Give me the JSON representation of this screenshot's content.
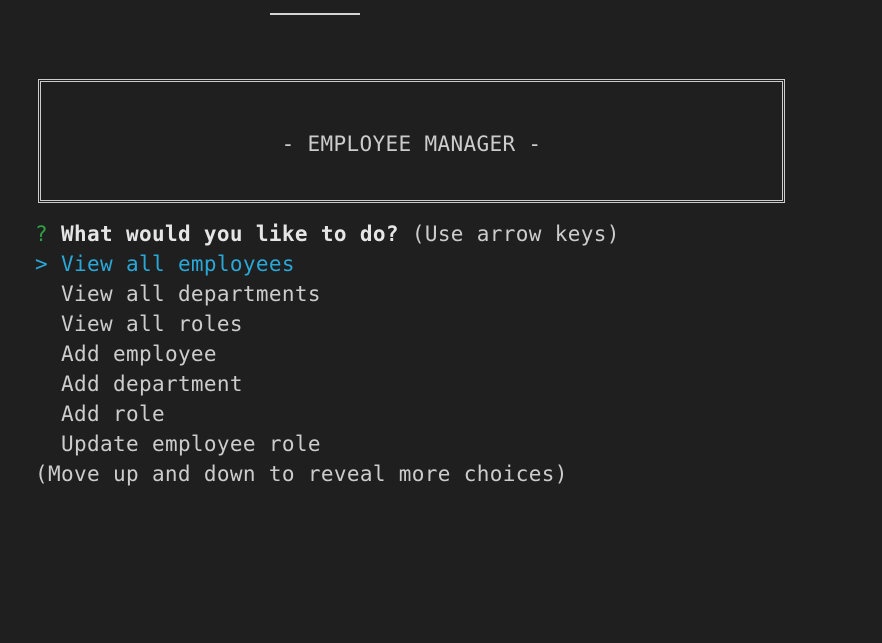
{
  "banner": {
    "title": "- EMPLOYEE MANAGER -"
  },
  "prompt": {
    "mark": "?",
    "question": "What would you like to do?",
    "instruction": "(Use arrow keys)"
  },
  "menu": {
    "pointer": ">",
    "selected_index": 0,
    "choices": [
      "View all employees",
      "View all departments",
      "View all roles",
      "Add employee",
      "Add department",
      "Add role",
      "Update employee role"
    ]
  },
  "footer_hint": "(Move up and down to reveal more choices)",
  "colors": {
    "background": "#1f1f1f",
    "text": "#cccccc",
    "question_mark": "#2ea043",
    "selection": "#29a8d8"
  }
}
